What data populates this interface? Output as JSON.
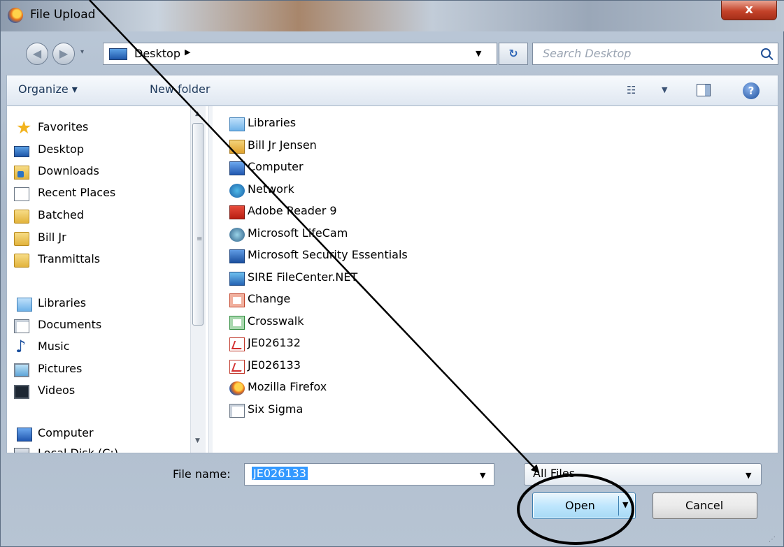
{
  "window": {
    "title": "File Upload",
    "close": "x"
  },
  "nav": {
    "address": "Desktop",
    "search_placeholder": "Search Desktop",
    "back": "◀",
    "forward": "▶",
    "history": "▾",
    "chevron": "▶",
    "address_drop": "▼",
    "refresh": "↻"
  },
  "toolbar": {
    "organize": "Organize ▾",
    "new_folder": "New folder",
    "view": "☷",
    "view_drop": "▼",
    "help": "?"
  },
  "sidebar": {
    "favorites": "Favorites",
    "favorites_items": [
      "Desktop",
      "Downloads",
      "Recent Places",
      "Batched",
      "Bill Jr",
      "Tranmittals"
    ],
    "libraries": "Libraries",
    "libraries_items": [
      "Documents",
      "Music",
      "Pictures",
      "Videos"
    ],
    "computer": "Computer",
    "computer_items": [
      "Local Disk (C:)"
    ],
    "scroll_up": "▲",
    "scroll_down": "▼",
    "grip": "≡"
  },
  "files": [
    "Libraries",
    "Bill Jr Jensen",
    "Computer",
    "Network",
    "Adobe Reader 9",
    "Microsoft LifeCam",
    "Microsoft Security Essentials",
    "SIRE FileCenter.NET",
    "Change",
    "Crosswalk",
    "JE026132",
    "JE026133",
    "Mozilla Firefox",
    "Six Sigma"
  ],
  "footer": {
    "file_name_label": "File name:",
    "file_name_value": "JE026133",
    "file_type": "All Files",
    "open": "Open",
    "cancel": "Cancel",
    "drop": "▼",
    "grip": "⋰"
  },
  "colors": {
    "annotation": "#000000",
    "selection": "#3399ff"
  }
}
